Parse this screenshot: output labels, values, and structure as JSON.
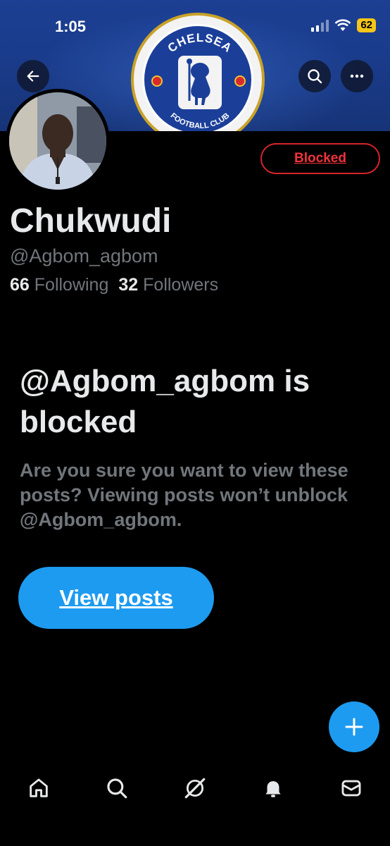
{
  "status_bar": {
    "time": "1:05",
    "battery": "62"
  },
  "banner": {
    "crest_top_text": "CHELSEA",
    "crest_bottom_text": "FOOTBALL CLUB"
  },
  "header": {
    "back_icon": "arrow-left-icon",
    "search_icon": "search-icon",
    "more_icon": "more-horizontal-icon"
  },
  "profile": {
    "name": "Chukwudi",
    "handle": "@Agbom_agbom",
    "following_count": "66",
    "following_label": "Following",
    "followers_count": "32",
    "followers_label": "Followers",
    "blocked_button_label": "Blocked"
  },
  "blocked_notice": {
    "title": "@Agbom_agbom is blocked",
    "description": "Are you sure you want to view these posts? Viewing posts won’t unblock @Agbom_agbom.",
    "view_button_label": "View posts"
  },
  "fab": {
    "icon": "plus-icon"
  },
  "tabbar": {
    "items": [
      {
        "name": "home",
        "icon": "home-icon"
      },
      {
        "name": "search",
        "icon": "search-icon"
      },
      {
        "name": "grok",
        "icon": "grok-icon"
      },
      {
        "name": "notifications",
        "icon": "bell-icon"
      },
      {
        "name": "messages",
        "icon": "mail-icon"
      }
    ]
  },
  "colors": {
    "accent": "#1d9bf0",
    "blocked_red": "#d6242c",
    "muted_text": "#71767b",
    "banner_blue": "#1c3f93"
  }
}
